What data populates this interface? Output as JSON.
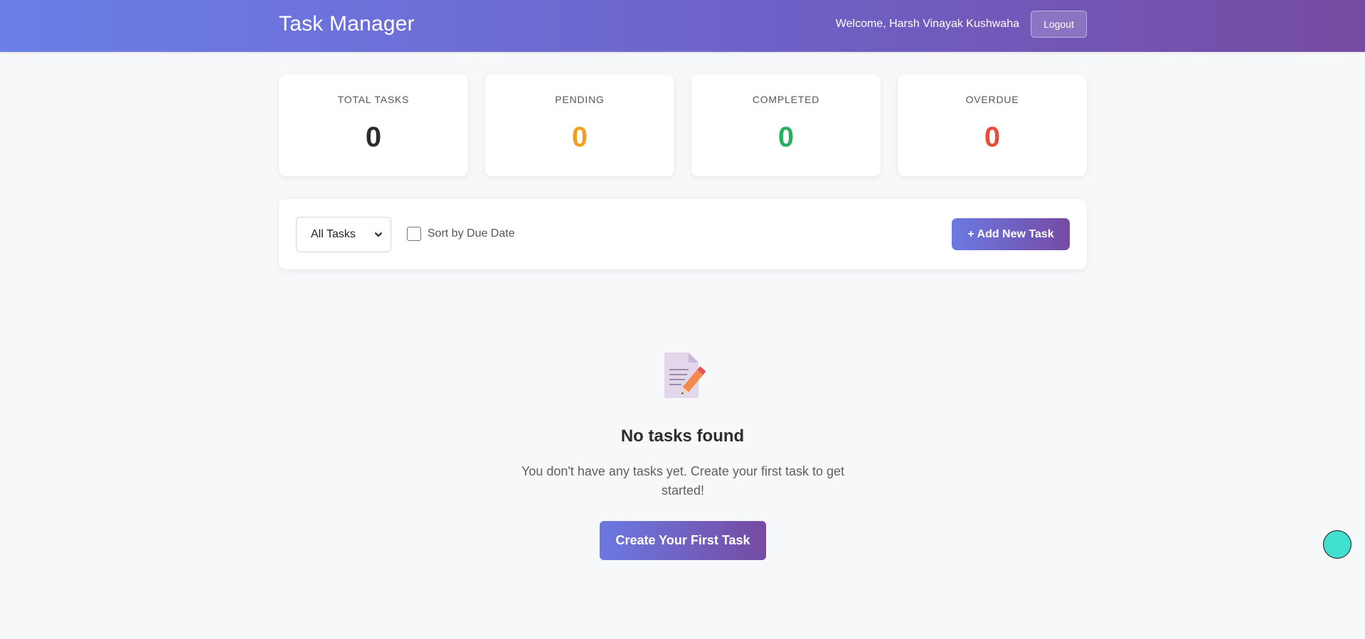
{
  "header": {
    "title": "Task Manager",
    "welcome_text": "Welcome, Harsh Vinayak Kushwaha",
    "logout_label": "Logout"
  },
  "stats": [
    {
      "label": "TOTAL TASKS",
      "value": "0",
      "color": "#2d2d2d"
    },
    {
      "label": "PENDING",
      "value": "0",
      "color": "#f0a020"
    },
    {
      "label": "COMPLETED",
      "value": "0",
      "color": "#27ae60"
    },
    {
      "label": "OVERDUE",
      "value": "0",
      "color": "#e74c3c"
    }
  ],
  "toolbar": {
    "filter_selected": "All Tasks",
    "sort_label": "Sort by Due Date",
    "sort_checked": false,
    "add_label": "+ Add New Task"
  },
  "empty_state": {
    "icon": "memo-icon",
    "title": "No tasks found",
    "message": "You don't have any tasks yet. Create your first task to get started!",
    "cta_label": "Create Your First Task"
  },
  "colors": {
    "accent_start": "#6b79e2",
    "accent_end": "#764ba2",
    "floating_button": "#3fe0cf"
  }
}
